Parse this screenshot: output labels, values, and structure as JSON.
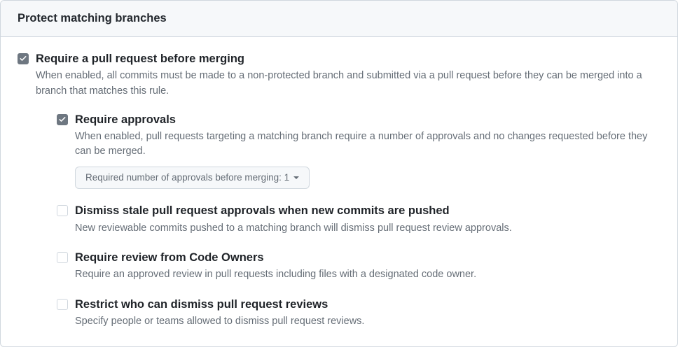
{
  "header": {
    "title": "Protect matching branches"
  },
  "requirePR": {
    "checked": true,
    "title": "Require a pull request before merging",
    "desc": "When enabled, all commits must be made to a non-protected branch and submitted via a pull request before they can be merged into a branch that matches this rule."
  },
  "requireApprovals": {
    "checked": true,
    "title": "Require approvals",
    "desc": "When enabled, pull requests targeting a matching branch require a number of approvals and no changes requested before they can be merged.",
    "dropdownLabel": "Required number of approvals before merging: 1"
  },
  "dismissStale": {
    "checked": false,
    "title": "Dismiss stale pull request approvals when new commits are pushed",
    "desc": "New reviewable commits pushed to a matching branch will dismiss pull request review approvals."
  },
  "codeOwners": {
    "checked": false,
    "title": "Require review from Code Owners",
    "desc": "Require an approved review in pull requests including files with a designated code owner."
  },
  "restrictDismiss": {
    "checked": false,
    "title": "Restrict who can dismiss pull request reviews",
    "desc": "Specify people or teams allowed to dismiss pull request reviews."
  }
}
